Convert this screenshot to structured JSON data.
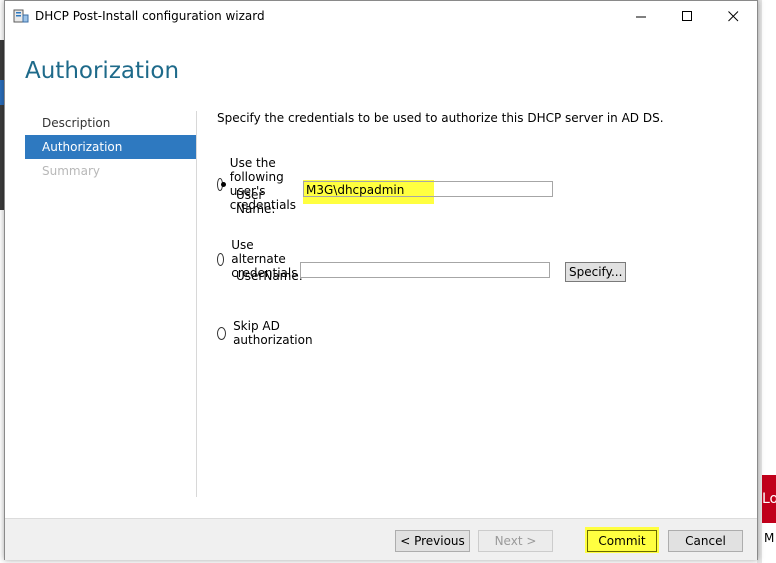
{
  "window": {
    "title": "DHCP Post-Install configuration wizard",
    "icons": {
      "app": "dhcp-server-icon",
      "minimize": "minimize-icon",
      "maximize": "maximize-icon",
      "close": "close-icon"
    }
  },
  "page": {
    "title": "Authorization"
  },
  "nav": {
    "items": [
      {
        "label": "Description",
        "state": "normal"
      },
      {
        "label": "Authorization",
        "state": "active"
      },
      {
        "label": "Summary",
        "state": "disabled"
      }
    ]
  },
  "content": {
    "description": "Specify the credentials to be used to authorize this DHCP server in AD DS.",
    "option_user": {
      "label": "Use the following user's credentials",
      "selected": true,
      "username_label": "User Name:",
      "username_value": "M3G\\dhcpadmin"
    },
    "option_alternate": {
      "label": "Use alternate credentials",
      "selected": false,
      "username_label": "UserName:",
      "username_value": "",
      "specify_label": "Specify..."
    },
    "option_skip": {
      "label": "Skip AD authorization",
      "selected": false
    }
  },
  "footer": {
    "previous_label": "< Previous",
    "next_label": "Next >",
    "commit_label": "Commit",
    "cancel_label": "Cancel"
  },
  "colors": {
    "accent": "#2e79c0",
    "title": "#1e6a8a",
    "highlight": "#ffff40"
  },
  "background": {
    "right_red_text": "Lo",
    "right_bottom_text": "M"
  }
}
